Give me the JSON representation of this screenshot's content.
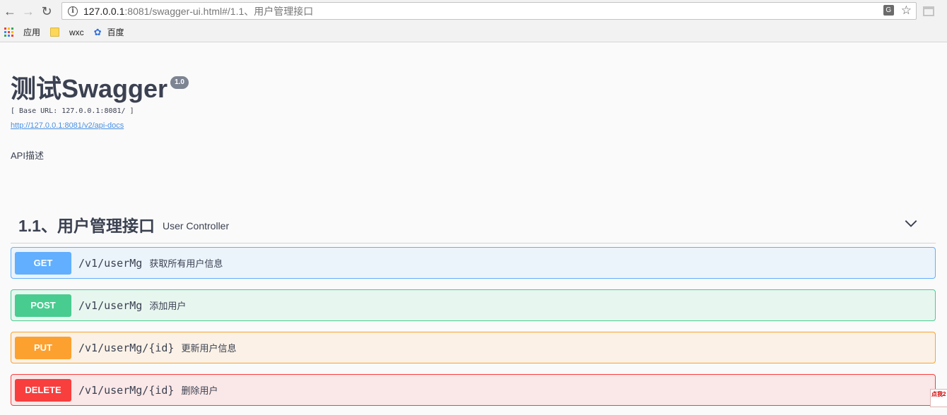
{
  "browser": {
    "url_host": "127.0.0.1",
    "url_rest": ":8081/swagger-ui.html#/1.1、用户管理接口",
    "bookmarks": [
      {
        "label": "应用"
      },
      {
        "label": "wxc"
      },
      {
        "label": "百度"
      }
    ]
  },
  "info": {
    "title": "测试Swagger",
    "version": "1.0",
    "base_url": "[ Base URL: 127.0.0.1:8081/ ]",
    "api_docs_link": "http://127.0.0.1:8081/v2/api-docs",
    "description": "API描述"
  },
  "tag": {
    "name": "1.1、用户管理接口",
    "description": "User Controller"
  },
  "operations": [
    {
      "method": "GET",
      "path": "/v1/userMg",
      "summary": "获取所有用户信息",
      "color": "#61affe"
    },
    {
      "method": "POST",
      "path": "/v1/userMg",
      "summary": "添加用户",
      "color": "#49cc90"
    },
    {
      "method": "PUT",
      "path": "/v1/userMg/{id}",
      "summary": "更新用户信息",
      "color": "#fca130"
    },
    {
      "method": "DELETE",
      "path": "/v1/userMg/{id}",
      "summary": "删除用户",
      "color": "#f93e3e"
    }
  ],
  "corner_badge": "点我2"
}
